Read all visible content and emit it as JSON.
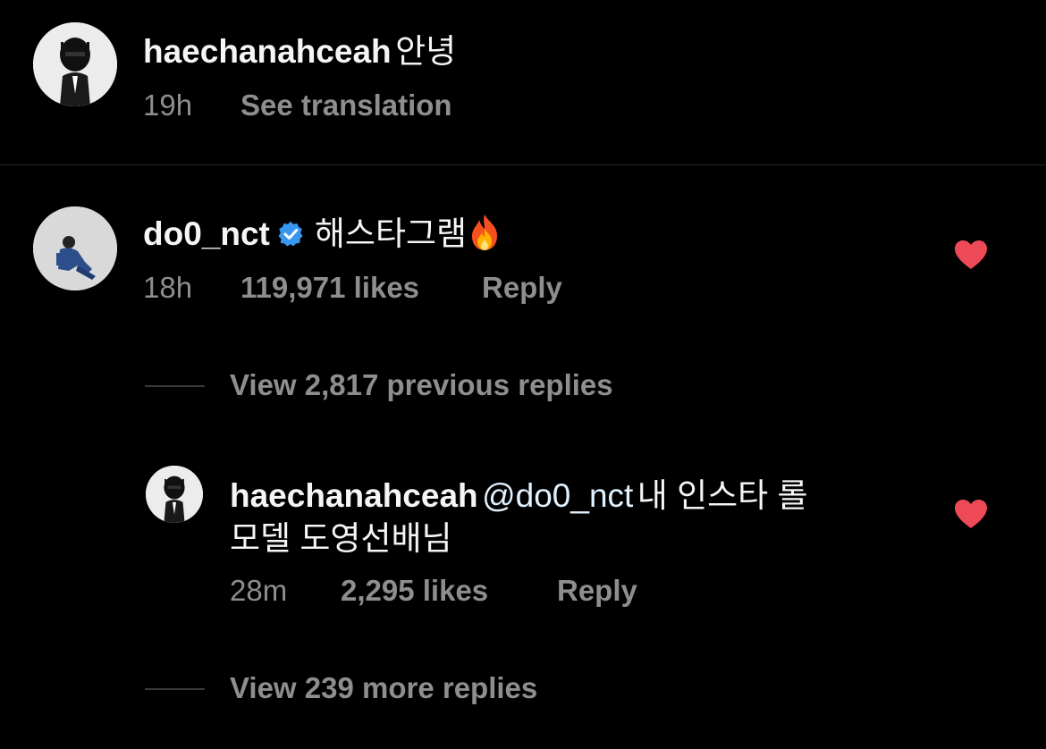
{
  "comment1": {
    "username": "haechanahceah",
    "text": "안녕",
    "time": "19h",
    "action": "See translation"
  },
  "comment2": {
    "username": "do0_nct",
    "text": "해스타그램",
    "emoji": "🔥",
    "time": "18h",
    "likes": "119,971 likes",
    "reply": "Reply",
    "view_previous": "View 2,817 previous replies"
  },
  "reply1": {
    "username": "haechanahceah",
    "mention": "@do0_nct",
    "text_line1": "내 인스타 롤",
    "text_line2": "모델 도영선배님",
    "time": "28m",
    "likes": "2,295 likes",
    "reply": "Reply",
    "view_more": "View 239 more replies"
  },
  "colors": {
    "background": "#000000",
    "primary_text": "#f5f5f5",
    "secondary_text": "#8e8e8e",
    "heart": "#ed4956",
    "verified": "#3897f0",
    "mention": "#e0f1ff"
  },
  "icons": {
    "verified": "verified-badge-icon",
    "heart": "heart-icon",
    "fire": "fire-emoji-icon"
  }
}
